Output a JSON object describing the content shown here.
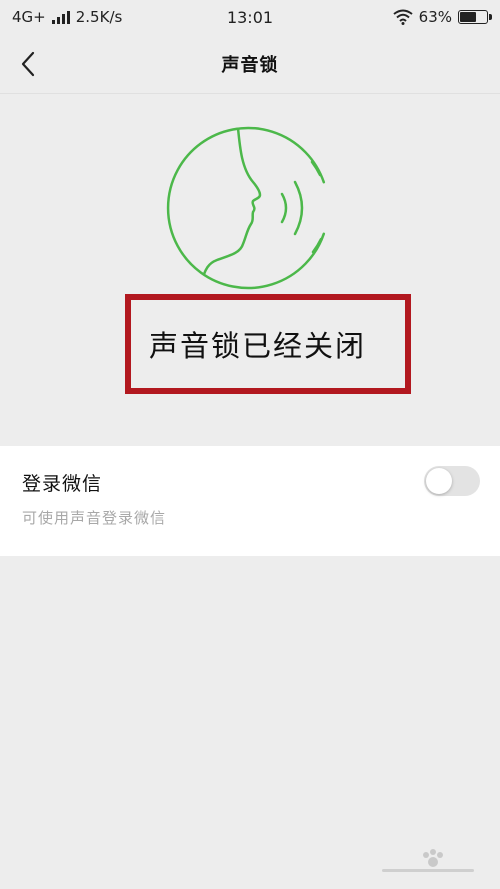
{
  "status_bar": {
    "network": "4G+",
    "speed": "2.5K/s",
    "time": "13:01",
    "battery_percent": "63%",
    "battery_level": 0.63
  },
  "nav": {
    "title": "声音锁",
    "back_icon": "chevron-left-icon"
  },
  "main": {
    "illustration_icon": "voice-face-icon",
    "status_text": "声音锁已经关闭",
    "highlight_color": "#b2181f"
  },
  "settings": {
    "login_wechat_label": "登录微信",
    "login_wechat_desc": "可使用声音登录微信",
    "toggle_on": false
  },
  "colors": {
    "accent_green": "#4cb84a",
    "background": "#ededed"
  }
}
